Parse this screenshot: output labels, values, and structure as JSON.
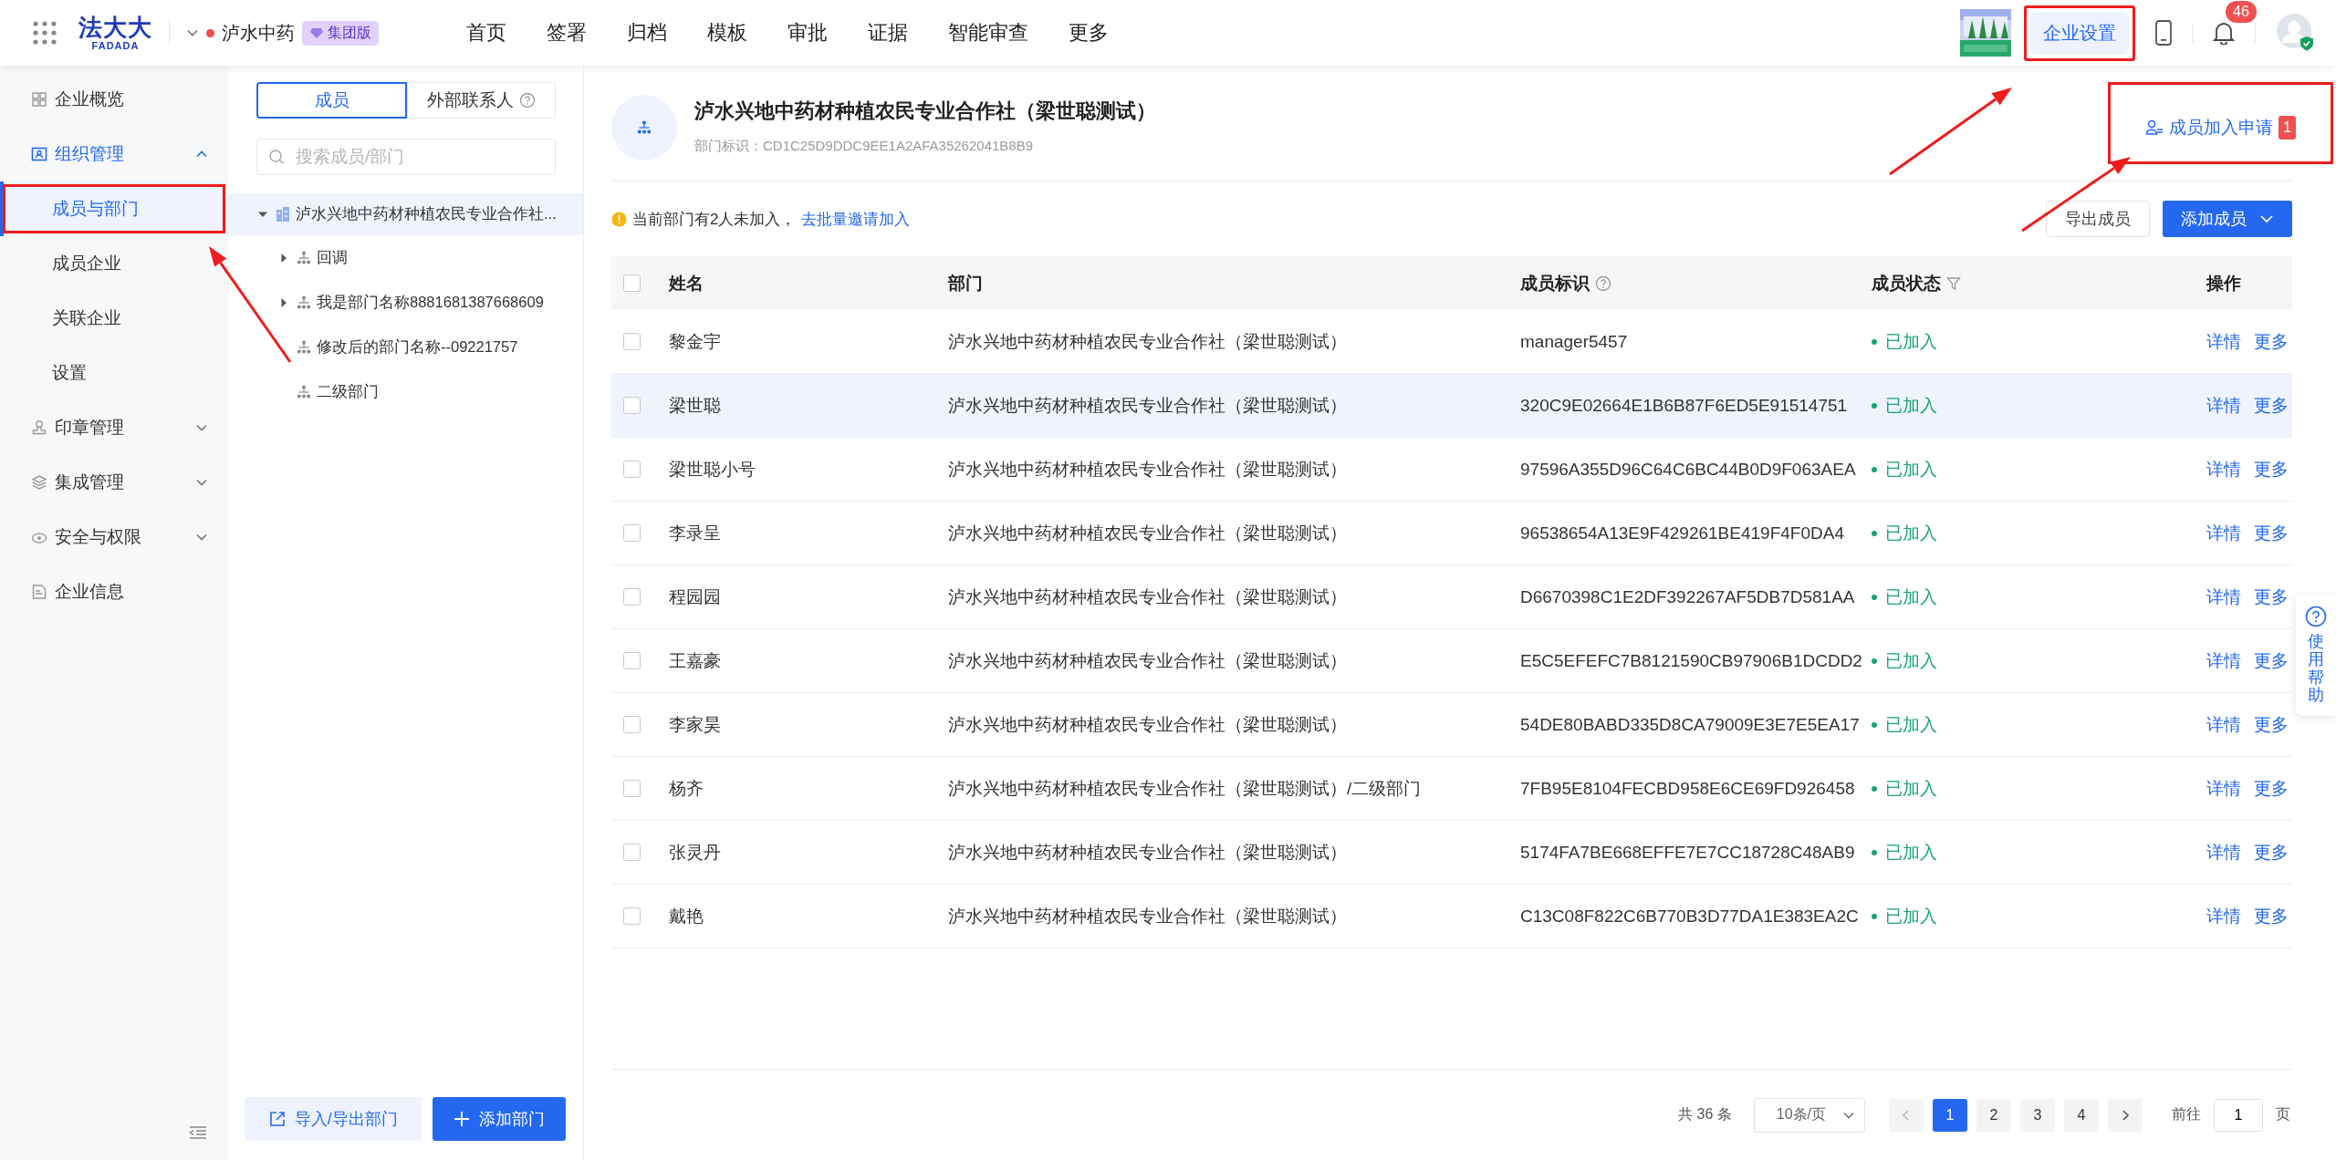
{
  "topbar": {
    "logo_text": "法大大",
    "logo_subtext": "FADADA",
    "org_name": "泸水中药",
    "edition": "集团版",
    "nav": [
      {
        "label": "首页"
      },
      {
        "label": "签署"
      },
      {
        "label": "归档"
      },
      {
        "label": "模板"
      },
      {
        "label": "审批"
      },
      {
        "label": "证据"
      },
      {
        "label": "智能审查"
      },
      {
        "label": "更多"
      }
    ],
    "settings_button": {
      "label": "企业设置",
      "highlighted": true
    },
    "notification_count": "46"
  },
  "sidebar": {
    "items": [
      {
        "label": "企业概览",
        "kind": "item",
        "selected": false
      },
      {
        "label": "组织管理",
        "kind": "group",
        "selected": true,
        "expanded": true,
        "children": [
          {
            "label": "成员与部门",
            "selected": true,
            "highlighted": true
          },
          {
            "label": "成员企业",
            "selected": false,
            "highlighted": false
          },
          {
            "label": "关联企业",
            "selected": false,
            "highlighted": false
          },
          {
            "label": "设置",
            "selected": false,
            "highlighted": false
          }
        ]
      },
      {
        "label": "印章管理",
        "kind": "group",
        "selected": false,
        "expanded": false
      },
      {
        "label": "集成管理",
        "kind": "group",
        "selected": false,
        "expanded": false
      },
      {
        "label": "安全与权限",
        "kind": "group",
        "selected": false,
        "expanded": false
      },
      {
        "label": "企业信息",
        "kind": "item",
        "selected": false
      }
    ]
  },
  "tree_panel": {
    "tabs": [
      {
        "label": "成员",
        "selected": true,
        "kind": "plain"
      },
      {
        "label": "外部联系人",
        "selected": false,
        "kind": "help"
      }
    ],
    "search": {
      "placeholder": "搜索成员/部门"
    },
    "tree": {
      "label": "泸水兴地中药材种植农民专业合作社...",
      "expanded": true,
      "selected": true,
      "children": [
        {
          "label": "回调",
          "expanded": false,
          "selected": false
        },
        {
          "label": "我是部门名称8881681387668609",
          "expanded": false,
          "selected": false
        },
        {
          "label": "修改后的部门名称--09221757",
          "selected": false
        },
        {
          "label": "二级部门",
          "selected": false
        }
      ]
    },
    "buttons": [
      {
        "label": "导入/导出部门",
        "kind": "secondary"
      },
      {
        "label": "添加部门",
        "kind": "primary"
      }
    ]
  },
  "header": {
    "title": "泸水兴地中药材种植农民专业合作社（梁世聪测试）",
    "subtitle": "部门标识：CD1C25D9DDC9EE1A2AFA35262041B8B9",
    "join_request": {
      "label": "成员加入申请",
      "count": "1",
      "highlighted": true
    }
  },
  "notice": {
    "text": "当前部门有2人未加入，",
    "link": "去批量邀请加入"
  },
  "actions": [
    {
      "label": "导出成员",
      "kind": "secondary"
    },
    {
      "label": "添加成员",
      "kind": "primary"
    }
  ],
  "table": {
    "all_checked": false,
    "columns": [
      {
        "label": "姓名",
        "kind": "plain"
      },
      {
        "label": "部门",
        "kind": "plain"
      },
      {
        "label": "成员标识",
        "kind": "help"
      },
      {
        "label": "成员状态",
        "kind": "filter"
      },
      {
        "label": "操作",
        "kind": "plain"
      }
    ],
    "rows": [
      {
        "checked": false,
        "hovered": false,
        "name": "黎金宇",
        "department": "泸水兴地中药材种植农民专业合作社（梁世聪测试）",
        "member_id": "manager5457",
        "status": "已加入",
        "actions": [
          "详情",
          "更多"
        ]
      },
      {
        "checked": false,
        "hovered": true,
        "name": "梁世聪",
        "department": "泸水兴地中药材种植农民专业合作社（梁世聪测试）",
        "member_id": "320C9E02664E1B6B87F6ED5E91514751",
        "status": "已加入",
        "actions": [
          "详情",
          "更多"
        ]
      },
      {
        "checked": false,
        "hovered": false,
        "name": "梁世聪小号",
        "department": "泸水兴地中药材种植农民专业合作社（梁世聪测试）",
        "member_id": "97596A355D96C64C6BC44B0D9F063AEA",
        "status": "已加入",
        "actions": [
          "详情",
          "更多"
        ]
      },
      {
        "checked": false,
        "hovered": false,
        "name": "李录呈",
        "department": "泸水兴地中药材种植农民专业合作社（梁世聪测试）",
        "member_id": "96538654A13E9F429261BE419F4F0DA4",
        "status": "已加入",
        "actions": [
          "详情",
          "更多"
        ]
      },
      {
        "checked": false,
        "hovered": false,
        "name": "程园园",
        "department": "泸水兴地中药材种植农民专业合作社（梁世聪测试）",
        "member_id": "D6670398C1E2DF392267AF5DB7D581AA",
        "status": "已加入",
        "actions": [
          "详情",
          "更多"
        ]
      },
      {
        "checked": false,
        "hovered": false,
        "name": "王嘉豪",
        "department": "泸水兴地中药材种植农民专业合作社（梁世聪测试）",
        "member_id": "E5C5EFEFC7B8121590CB97906B1DCDD2",
        "status": "已加入",
        "actions": [
          "详情",
          "更多"
        ]
      },
      {
        "checked": false,
        "hovered": false,
        "name": "李家昊",
        "department": "泸水兴地中药材种植农民专业合作社（梁世聪测试）",
        "member_id": "54DE80BABD335D8CA79009E3E7E5EA17",
        "status": "已加入",
        "actions": [
          "详情",
          "更多"
        ]
      },
      {
        "checked": false,
        "hovered": false,
        "name": "杨齐",
        "department": "泸水兴地中药材种植农民专业合作社（梁世聪测试）/二级部门",
        "member_id": "7FB95E8104FECBD958E6CE69FD926458",
        "status": "已加入",
        "actions": [
          "详情",
          "更多"
        ]
      },
      {
        "checked": false,
        "hovered": false,
        "name": "张灵丹",
        "department": "泸水兴地中药材种植农民专业合作社（梁世聪测试）",
        "member_id": "5174FA7BE668EFFE7E7CC18728C48AB9",
        "status": "已加入",
        "actions": [
          "详情",
          "更多"
        ]
      },
      {
        "checked": false,
        "hovered": false,
        "name": "戴艳",
        "department": "泸水兴地中药材种植农民专业合作社（梁世聪测试）",
        "member_id": "C13C08F822C6B770B3D77DA1E383EA2C",
        "status": "已加入",
        "actions": [
          "详情",
          "更多"
        ]
      }
    ]
  },
  "pagination": {
    "total": "共 36 条",
    "page_size": "10条/页",
    "pages": [
      {
        "label": "1",
        "selected": true
      },
      {
        "label": "2",
        "selected": false
      },
      {
        "label": "3",
        "selected": false
      },
      {
        "label": "4",
        "selected": false
      }
    ],
    "goto_label": "前往",
    "goto_value": "1",
    "goto_suffix": "页"
  },
  "help_widget": {
    "label": "使用帮助"
  }
}
